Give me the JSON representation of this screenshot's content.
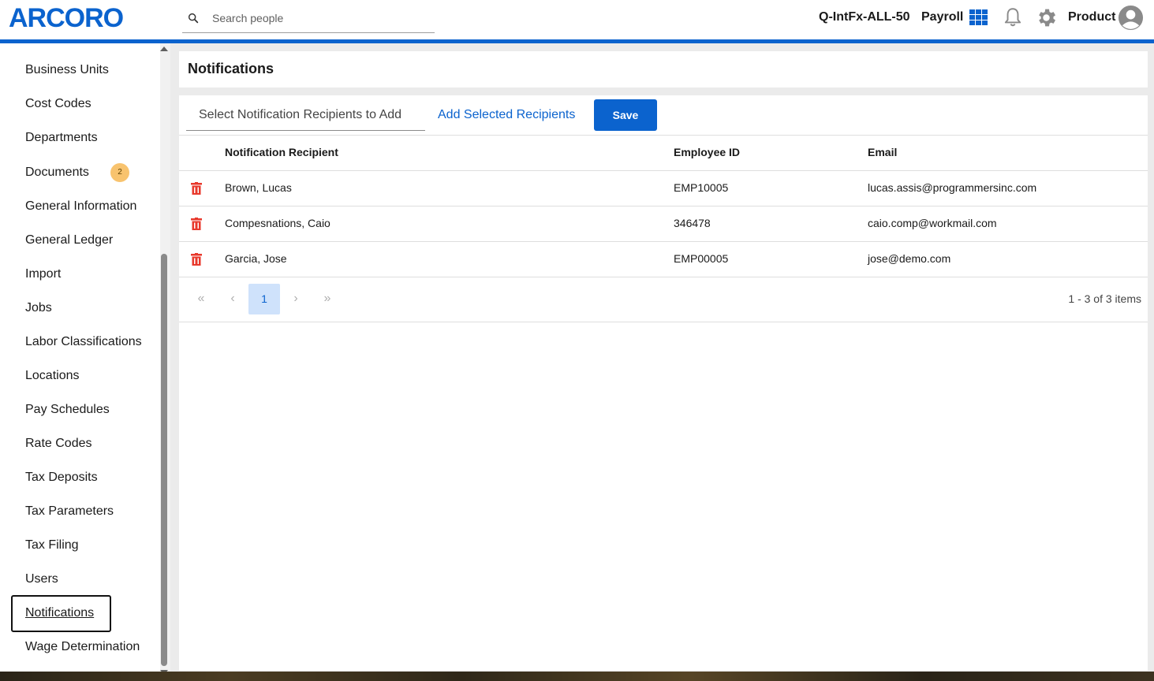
{
  "header": {
    "logo": "ARCORO",
    "search_placeholder": "Search people",
    "company": "Q-IntFx-ALL-50",
    "product": "Payroll",
    "user": "Product",
    "brand_color": "#0b63ce"
  },
  "sidebar": {
    "items": [
      {
        "label": "Business Units"
      },
      {
        "label": "Cost Codes"
      },
      {
        "label": "Departments"
      },
      {
        "label": "Documents",
        "badge": "2"
      },
      {
        "label": "General Information"
      },
      {
        "label": "General Ledger"
      },
      {
        "label": "Import"
      },
      {
        "label": "Jobs"
      },
      {
        "label": "Labor Classifications"
      },
      {
        "label": "Locations"
      },
      {
        "label": "Pay Schedules"
      },
      {
        "label": "Rate Codes"
      },
      {
        "label": "Tax Deposits"
      },
      {
        "label": "Tax Parameters"
      },
      {
        "label": "Tax Filing"
      },
      {
        "label": "Users"
      },
      {
        "label": "Notifications"
      },
      {
        "label": "Wage Determination"
      }
    ],
    "active": "Notifications"
  },
  "page": {
    "title": "Notifications",
    "recipient_select": "Select Notification Recipients to Add",
    "add_label": "Add Selected Recipients",
    "save_label": "Save"
  },
  "table": {
    "columns": [
      "Notification Recipient",
      "Employee ID",
      "Email"
    ],
    "rows": [
      {
        "name": "Brown, Lucas",
        "id": "EMP10005",
        "email": "lucas.assis@programmersinc.com"
      },
      {
        "name": "Compesnations, Caio",
        "id": "346478",
        "email": "caio.comp@workmail.com"
      },
      {
        "name": "Garcia, Jose",
        "id": "EMP00005",
        "email": "jose@demo.com"
      }
    ]
  },
  "pager": {
    "first": "«",
    "prev": "‹",
    "page": "1",
    "next": "›",
    "last": "»",
    "info": "1 - 3 of 3 items"
  }
}
